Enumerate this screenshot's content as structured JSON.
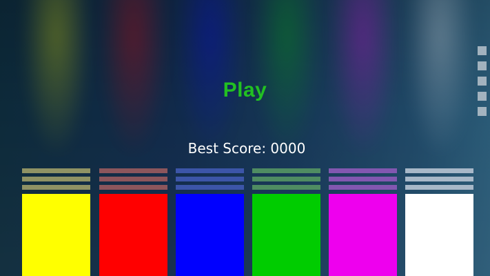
{
  "play_label": "Play",
  "best_score": {
    "label": "Best Score:",
    "value": "0000"
  },
  "colors": {
    "play": "#22c022",
    "lanes": [
      "#ffff00",
      "#ff0000",
      "#0000ff",
      "#00cc00",
      "#ee00ee",
      "#ffffff"
    ],
    "stripes": [
      "#8f9264",
      "#8c565c",
      "#3c55a8",
      "#4f8c62",
      "#8257b0",
      "#a8b8c8"
    ]
  },
  "side_menu_icon": "menu-squares"
}
